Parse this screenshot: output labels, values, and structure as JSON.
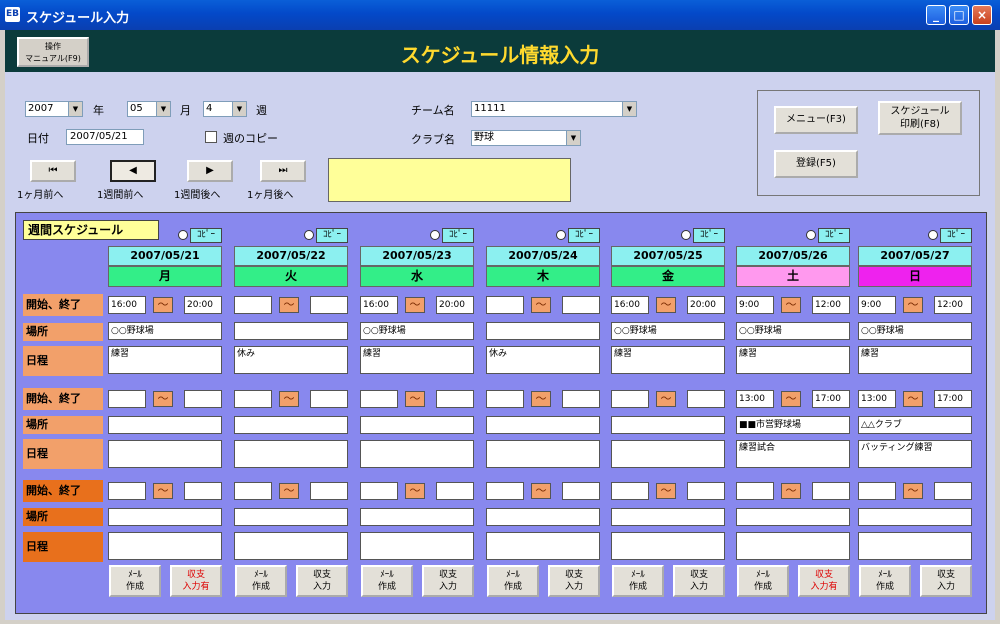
{
  "window": {
    "title": "スケジュール入力",
    "app_icon": "EB",
    "buttons": [
      "_",
      "□",
      "×"
    ]
  },
  "header": {
    "manual_button": [
      "操作",
      "マニュアル(F9)"
    ],
    "title": "スケジュール情報入力"
  },
  "form": {
    "year": "2007",
    "year_unit": "年",
    "month": "05",
    "month_unit": "月",
    "week": "4",
    "week_unit": "週",
    "date_label": "日付",
    "date_value": "2007/05/21",
    "copy_week_label": "週のコピー",
    "team_label": "チーム名",
    "team_value": "11111",
    "club_label": "クラブ名",
    "club_value": "野球"
  },
  "nav": [
    {
      "icon": "first-icon",
      "glyph": "⏮",
      "label": "1ヶ月前へ"
    },
    {
      "icon": "prev-icon",
      "glyph": "◀",
      "label": "1週間前へ"
    },
    {
      "icon": "next-icon",
      "glyph": "▶",
      "label": "1週間後へ"
    },
    {
      "icon": "last-icon",
      "glyph": "⏭",
      "label": "1ヶ月後へ"
    }
  ],
  "panel": {
    "menu": "メニュー(F3)",
    "print": [
      "スケジュール",
      "印刷(F8)"
    ],
    "register": "登録(F5)"
  },
  "schedule": {
    "title": "週間スケジュール",
    "copy_label": "ｺﾋﾟｰ",
    "tilde": "～",
    "row_labels": [
      "開始、終了",
      "場所",
      "日程",
      "開始、終了",
      "場所",
      "日程",
      "開始、終了",
      "場所",
      "日程"
    ],
    "days": [
      {
        "date": "2007/05/21",
        "dow": "月",
        "dow_color": "#33ee88",
        "slots": [
          {
            "start": "16:00",
            "end": "20:00",
            "place": "○○野球場",
            "program": "練習"
          },
          {
            "start": "",
            "end": "",
            "place": "",
            "program": ""
          },
          {
            "start": "",
            "end": "",
            "place": "",
            "program": ""
          }
        ],
        "btn1": [
          "ﾒｰﾙ",
          "作成"
        ],
        "btn2": [
          "収支",
          "入力有"
        ],
        "btn2_red": true
      },
      {
        "date": "2007/05/22",
        "dow": "火",
        "dow_color": "#33ee88",
        "slots": [
          {
            "start": "",
            "end": "",
            "place": "",
            "program": "休み"
          },
          {
            "start": "",
            "end": "",
            "place": "",
            "program": ""
          },
          {
            "start": "",
            "end": "",
            "place": "",
            "program": ""
          }
        ],
        "btn1": [
          "ﾒｰﾙ",
          "作成"
        ],
        "btn2": [
          "収支",
          "入力"
        ],
        "btn2_red": false
      },
      {
        "date": "2007/05/23",
        "dow": "水",
        "dow_color": "#33ee88",
        "slots": [
          {
            "start": "16:00",
            "end": "20:00",
            "place": "○○野球場",
            "program": "練習"
          },
          {
            "start": "",
            "end": "",
            "place": "",
            "program": ""
          },
          {
            "start": "",
            "end": "",
            "place": "",
            "program": ""
          }
        ],
        "btn1": [
          "ﾒｰﾙ",
          "作成"
        ],
        "btn2": [
          "収支",
          "入力"
        ],
        "btn2_red": false
      },
      {
        "date": "2007/05/24",
        "dow": "木",
        "dow_color": "#33ee88",
        "slots": [
          {
            "start": "",
            "end": "",
            "place": "",
            "program": "休み"
          },
          {
            "start": "",
            "end": "",
            "place": "",
            "program": ""
          },
          {
            "start": "",
            "end": "",
            "place": "",
            "program": ""
          }
        ],
        "btn1": [
          "ﾒｰﾙ",
          "作成"
        ],
        "btn2": [
          "収支",
          "入力"
        ],
        "btn2_red": false
      },
      {
        "date": "2007/05/25",
        "dow": "金",
        "dow_color": "#33ee88",
        "slots": [
          {
            "start": "16:00",
            "end": "20:00",
            "place": "○○野球場",
            "program": "練習"
          },
          {
            "start": "",
            "end": "",
            "place": "",
            "program": ""
          },
          {
            "start": "",
            "end": "",
            "place": "",
            "program": ""
          }
        ],
        "btn1": [
          "ﾒｰﾙ",
          "作成"
        ],
        "btn2": [
          "収支",
          "入力"
        ],
        "btn2_red": false
      },
      {
        "date": "2007/05/26",
        "dow": "土",
        "dow_color": "#ff99ee",
        "slots": [
          {
            "start": "9:00",
            "end": "12:00",
            "place": "○○野球場",
            "program": "練習"
          },
          {
            "start": "13:00",
            "end": "17:00",
            "place": "■■市営野球場",
            "program": "練習試合"
          },
          {
            "start": "",
            "end": "",
            "place": "",
            "program": ""
          }
        ],
        "btn1": [
          "ﾒｰﾙ",
          "作成"
        ],
        "btn2": [
          "収支",
          "入力有"
        ],
        "btn2_red": true
      },
      {
        "date": "2007/05/27",
        "dow": "日",
        "dow_color": "#ee22ee",
        "slots": [
          {
            "start": "9:00",
            "end": "12:00",
            "place": "○○野球場",
            "program": "練習"
          },
          {
            "start": "13:00",
            "end": "17:00",
            "place": "△△クラブ",
            "program": "バッティング練習"
          },
          {
            "start": "",
            "end": "",
            "place": "",
            "program": ""
          }
        ],
        "btn1": [
          "ﾒｰﾙ",
          "作成"
        ],
        "btn2": [
          "収支",
          "入力"
        ],
        "btn2_red": false
      }
    ]
  }
}
